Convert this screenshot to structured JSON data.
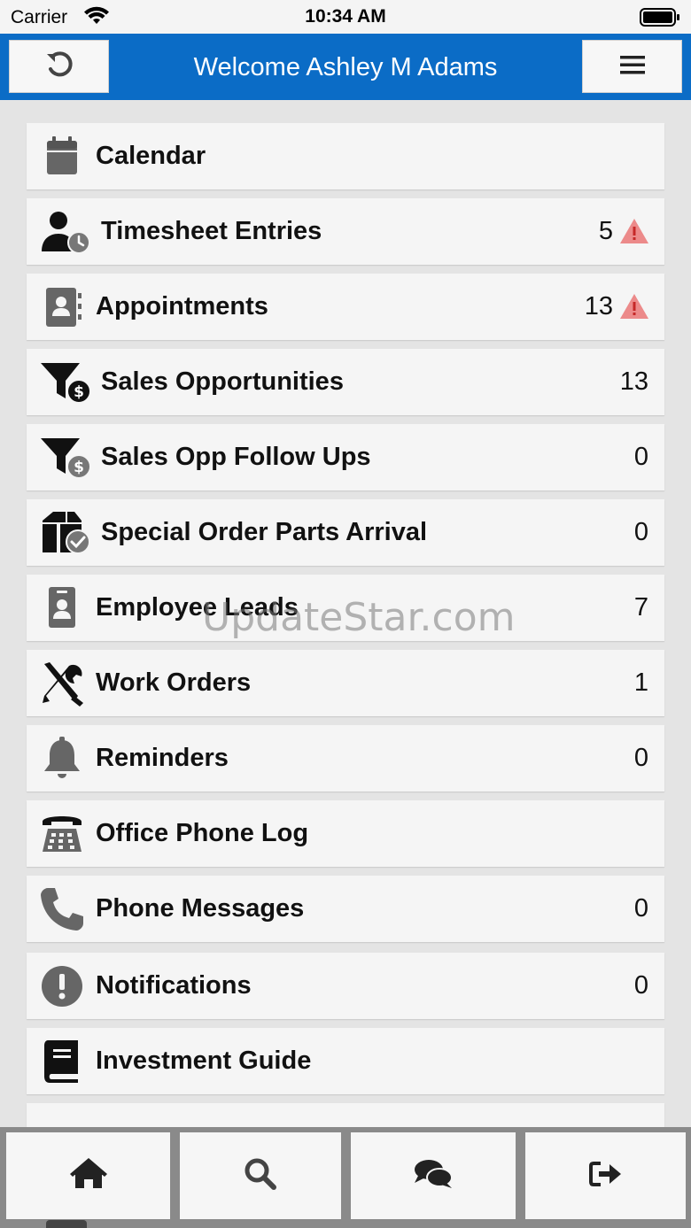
{
  "status": {
    "carrier": "Carrier",
    "time": "10:34 AM"
  },
  "header": {
    "title": "Welcome Ashley M Adams",
    "back_icon": "undo-icon",
    "menu_icon": "hamburger-menu-icon"
  },
  "menu": [
    {
      "label": "Calendar",
      "count": "",
      "warning": false,
      "icon": "calendar-icon"
    },
    {
      "label": "Timesheet Entries",
      "count": "5",
      "warning": true,
      "icon": "user-clock-icon"
    },
    {
      "label": "Appointments",
      "count": "13",
      "warning": true,
      "icon": "contact-book-icon"
    },
    {
      "label": "Sales Opportunities",
      "count": "13",
      "warning": false,
      "icon": "funnel-dollar-icon"
    },
    {
      "label": "Sales Opp Follow Ups",
      "count": "0",
      "warning": false,
      "icon": "funnel-dollar-grey-icon"
    },
    {
      "label": "Special Order Parts Arrival",
      "count": "0",
      "warning": false,
      "icon": "box-check-icon"
    },
    {
      "label": "Employee Leads",
      "count": "7",
      "warning": false,
      "icon": "id-badge-icon"
    },
    {
      "label": "Work Orders",
      "count": "1",
      "warning": false,
      "icon": "tools-icon"
    },
    {
      "label": "Reminders",
      "count": "0",
      "warning": false,
      "icon": "bell-icon"
    },
    {
      "label": "Office Phone Log",
      "count": "",
      "warning": false,
      "icon": "desk-phone-icon"
    },
    {
      "label": "Phone Messages",
      "count": "0",
      "warning": false,
      "icon": "phone-icon"
    },
    {
      "label": "Notifications",
      "count": "0",
      "warning": false,
      "icon": "exclamation-circle-icon"
    },
    {
      "label": "Investment Guide",
      "count": "",
      "warning": false,
      "icon": "book-icon"
    }
  ],
  "watermark": "UpdateStar.com",
  "tabbar": [
    {
      "icon": "home-icon"
    },
    {
      "icon": "search-icon"
    },
    {
      "icon": "chat-icon"
    },
    {
      "icon": "logout-icon"
    }
  ],
  "colors": {
    "header": "#0b6cc6",
    "warning": "#e57373",
    "background": "#e4e4e4"
  }
}
